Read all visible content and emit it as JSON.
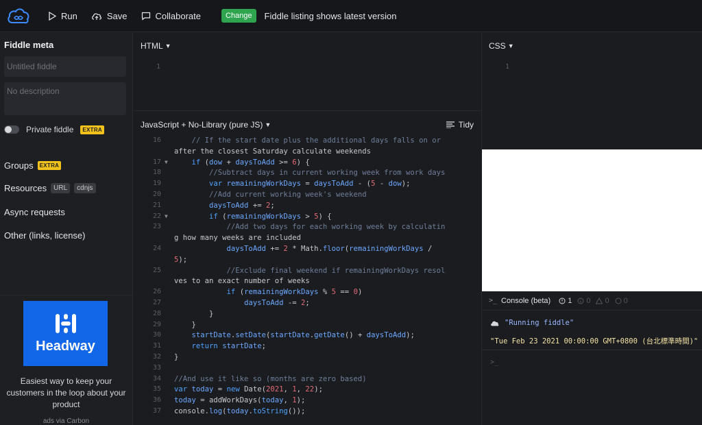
{
  "toolbar": {
    "run_label": "Run",
    "save_label": "Save",
    "collaborate_label": "Collaborate",
    "change_badge": "Change",
    "change_message": "Fiddle listing shows latest version"
  },
  "sidebar": {
    "title": "Fiddle meta",
    "name_placeholder": "Untitled fiddle",
    "description_placeholder": "No description",
    "private_label": "Private fiddle",
    "extra_badge": "EXTRA",
    "groups_label": "Groups",
    "resources_label": "Resources",
    "url_chip": "URL",
    "cdnjs_chip": "cdnjs",
    "async_label": "Async requests",
    "other_label": "Other (links, license)"
  },
  "ad": {
    "brand": "Headway",
    "copy": "Easiest way to keep your customers in the loop about your product",
    "via": "ads via Carbon"
  },
  "html_panel": {
    "title": "HTML",
    "line": "1"
  },
  "css_panel": {
    "title": "CSS",
    "line": "1"
  },
  "js_panel": {
    "title": "JavaScript + No-Library (pure JS)",
    "tidy_label": "Tidy",
    "lines": [
      {
        "num": "16",
        "fold": false,
        "text": "    // If the start date plus the additional days falls on or"
      },
      {
        "num": "",
        "fold": false,
        "text": "after the closest Saturday calculate weekends"
      },
      {
        "num": "17",
        "fold": true,
        "text": "    if (dow + daysToAdd >= 6) {"
      },
      {
        "num": "18",
        "fold": false,
        "text": "        //Subtract days in current working week from work days"
      },
      {
        "num": "19",
        "fold": false,
        "text": "        var remainingWorkDays = daysToAdd - (5 - dow);"
      },
      {
        "num": "20",
        "fold": false,
        "text": "        //Add current working week's weekend"
      },
      {
        "num": "21",
        "fold": false,
        "text": "        daysToAdd += 2;"
      },
      {
        "num": "22",
        "fold": true,
        "text": "        if (remainingWorkDays > 5) {"
      },
      {
        "num": "23",
        "fold": false,
        "text": "            //Add two days for each working week by calculatin"
      },
      {
        "num": "",
        "fold": false,
        "text": "g how many weeks are included"
      },
      {
        "num": "24",
        "fold": false,
        "text": "            daysToAdd += 2 * Math.floor(remainingWorkDays /"
      },
      {
        "num": "",
        "fold": false,
        "text": "5);"
      },
      {
        "num": "25",
        "fold": false,
        "text": "            //Exclude final weekend if remainingWorkDays resol"
      },
      {
        "num": "",
        "fold": false,
        "text": "ves to an exact number of weeks"
      },
      {
        "num": "26",
        "fold": false,
        "text": "            if (remainingWorkDays % 5 == 0)"
      },
      {
        "num": "27",
        "fold": false,
        "text": "                daysToAdd -= 2;"
      },
      {
        "num": "28",
        "fold": false,
        "text": "        }"
      },
      {
        "num": "29",
        "fold": false,
        "text": "    }"
      },
      {
        "num": "30",
        "fold": false,
        "text": "    startDate.setDate(startDate.getDate() + daysToAdd);"
      },
      {
        "num": "31",
        "fold": false,
        "text": "    return startDate;"
      },
      {
        "num": "32",
        "fold": false,
        "text": "}"
      },
      {
        "num": "33",
        "fold": false,
        "text": ""
      },
      {
        "num": "34",
        "fold": false,
        "text": "//And use it like so (months are zero based)"
      },
      {
        "num": "35",
        "fold": false,
        "text": "var today = new Date(2021, 1, 22);"
      },
      {
        "num": "36",
        "fold": false,
        "text": "today = addWorkDays(today, 1);"
      },
      {
        "num": "37",
        "fold": false,
        "text": "console.log(today.toString());"
      }
    ]
  },
  "console": {
    "title": "Console (beta)",
    "prompt": ">_",
    "counts": [
      "1",
      "0",
      "0",
      "0"
    ],
    "running_message": "\"Running fiddle\"",
    "output_message": "\"Tue Feb 23 2021 00:00:00 GMT+0800 (台北標準時間)\"",
    "input_prompt": ">_"
  },
  "colors": {
    "accent_green": "#2ea44f",
    "extra_yellow": "#f1c21b",
    "ad_blue": "#1266e8",
    "comment": "#6e7f9a",
    "keyword": "#4fa3ff",
    "number": "#e06c75",
    "identifier": "#6ca8ff"
  }
}
